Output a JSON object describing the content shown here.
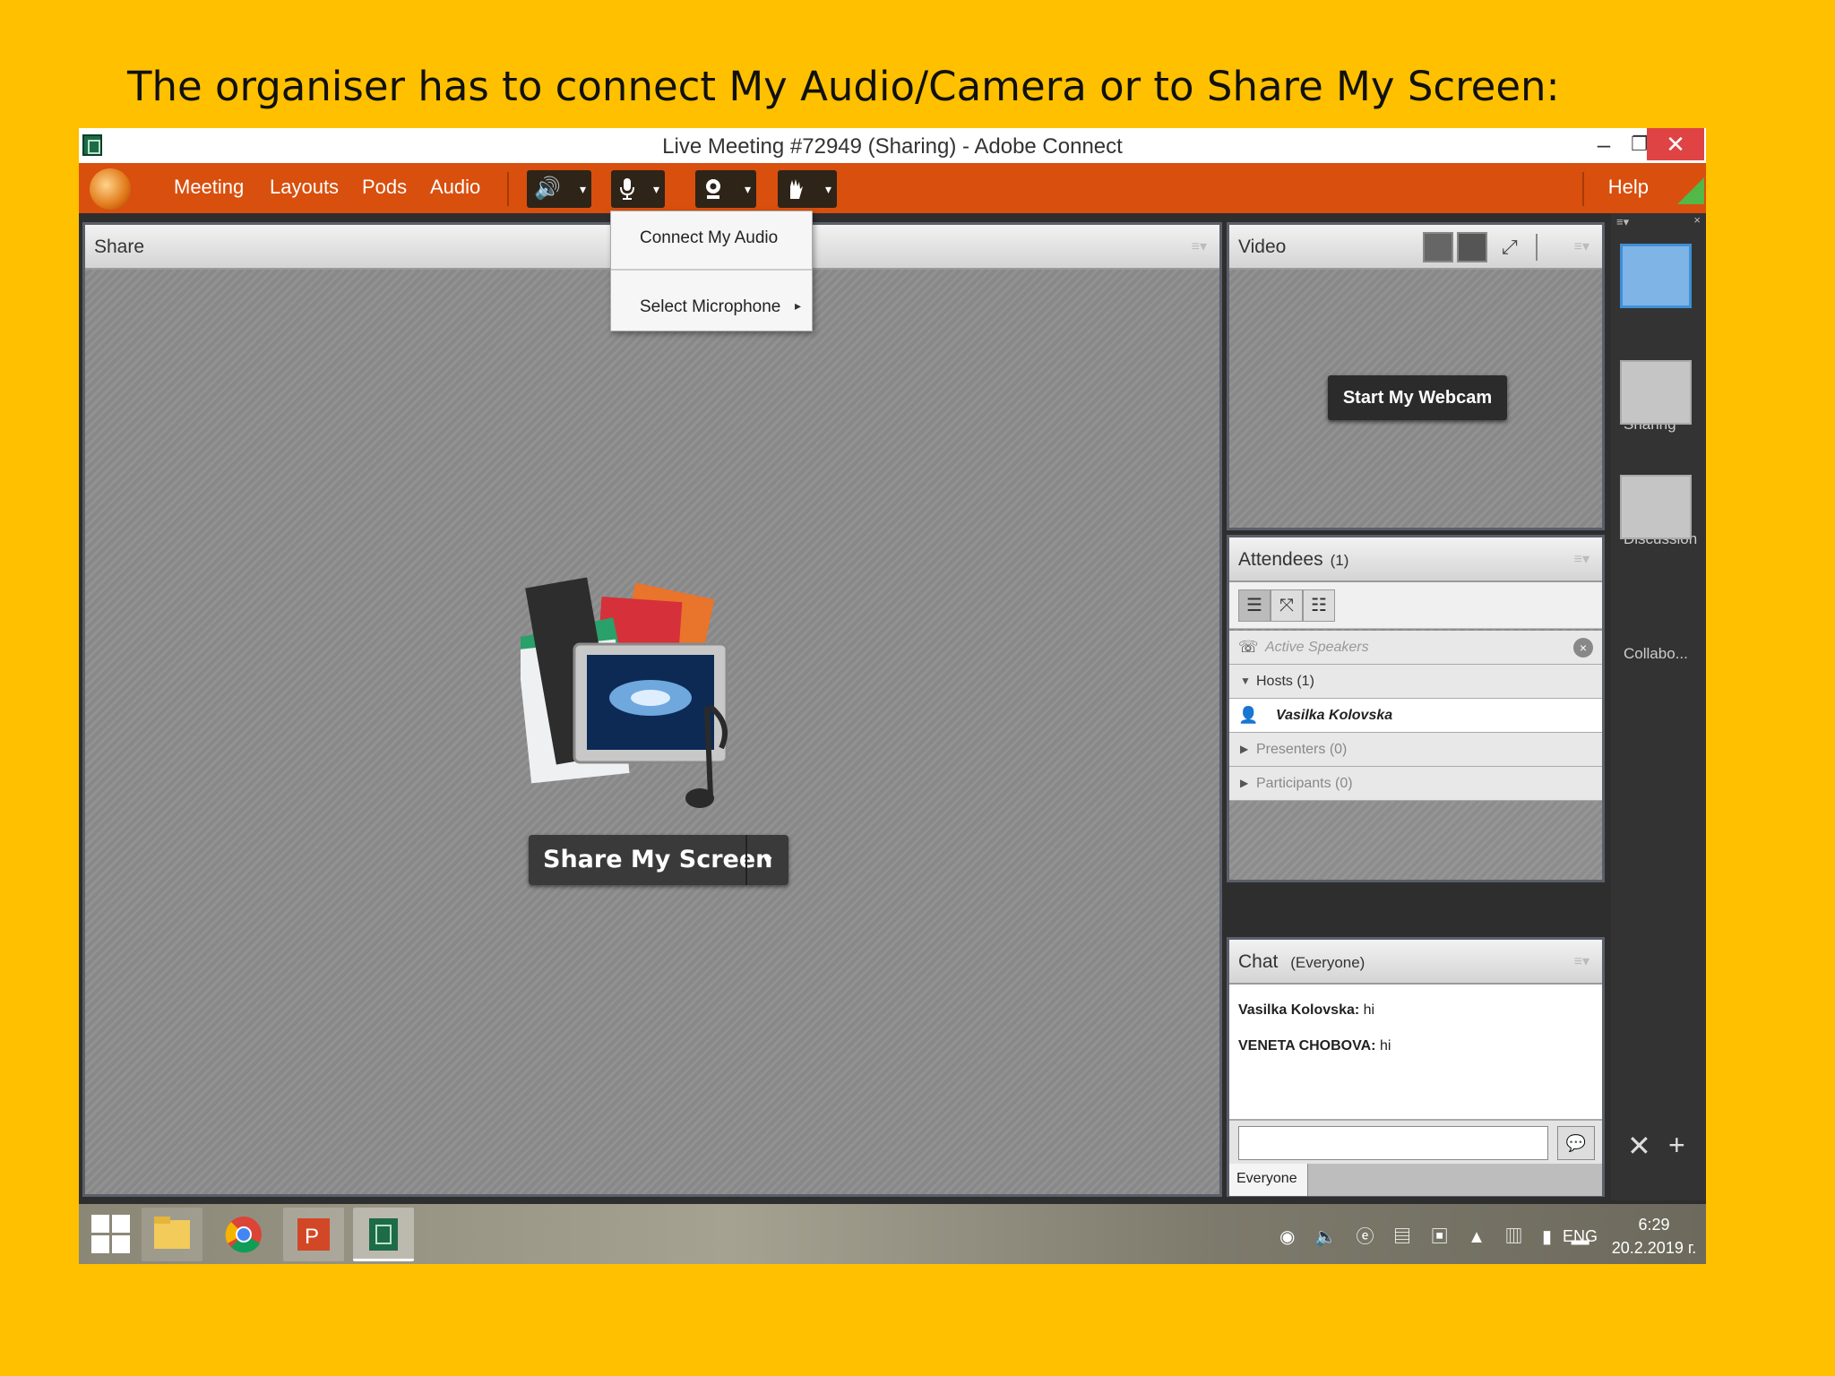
{
  "slide": {
    "title": "The organiser has to connect My Audio/Camera or to Share My Screen:"
  },
  "window": {
    "title": "Live Meeting #72949 (Sharing) - Adobe Connect",
    "min": "–",
    "max": "❐",
    "close": "✕"
  },
  "menubar": {
    "items": [
      "Meeting",
      "Layouts",
      "Pods",
      "Audio"
    ],
    "help": "Help"
  },
  "toolbar": {
    "dropdown_glyph": "▾"
  },
  "audio_dropdown": {
    "connect": "Connect My Audio",
    "select_mic": "Select Microphone",
    "submenu_glyph": "▸"
  },
  "share_pod": {
    "title": "Share",
    "share_button": "Share My Screen",
    "menu_glyph": "≡▾"
  },
  "video_pod": {
    "title": "Video",
    "webcam_button": "Start My Webcam",
    "menu_glyph": "≡▾"
  },
  "attendees_pod": {
    "title": "Attendees",
    "count": "(1)",
    "active_speakers": "Active Speakers",
    "hosts": "Hosts (1)",
    "host_name": "Vasilka Kolovska",
    "presenters": "Presenters (0)",
    "participants": "Participants (0)",
    "menu_glyph": "≡▾"
  },
  "chat_pod": {
    "title": "Chat",
    "scope": "(Everyone)",
    "messages": [
      {
        "sender": "Vasilka Kolovska:",
        "text": "hi"
      },
      {
        "sender": "VENETA CHOBOVA:",
        "text": "hi"
      }
    ],
    "tab": "Everyone",
    "menu_glyph": "≡▾",
    "send_glyph": "💬"
  },
  "layouts": [
    {
      "label": "Sharing",
      "active": true
    },
    {
      "label": "Discussion",
      "active": false
    },
    {
      "label": "Collabo...",
      "active": false
    }
  ],
  "layouts_bar": {
    "menu_glyph": "≡▾",
    "close_glyph": "×",
    "tool_glyph": "✕",
    "add_glyph": "+"
  },
  "taskbar": {
    "lang": "ENG",
    "time": "6:29",
    "date": "20.2.2019 г."
  },
  "colors": {
    "background": "#FFC000",
    "menubar": "#D94F0D",
    "accent": "#3F8FD6"
  }
}
